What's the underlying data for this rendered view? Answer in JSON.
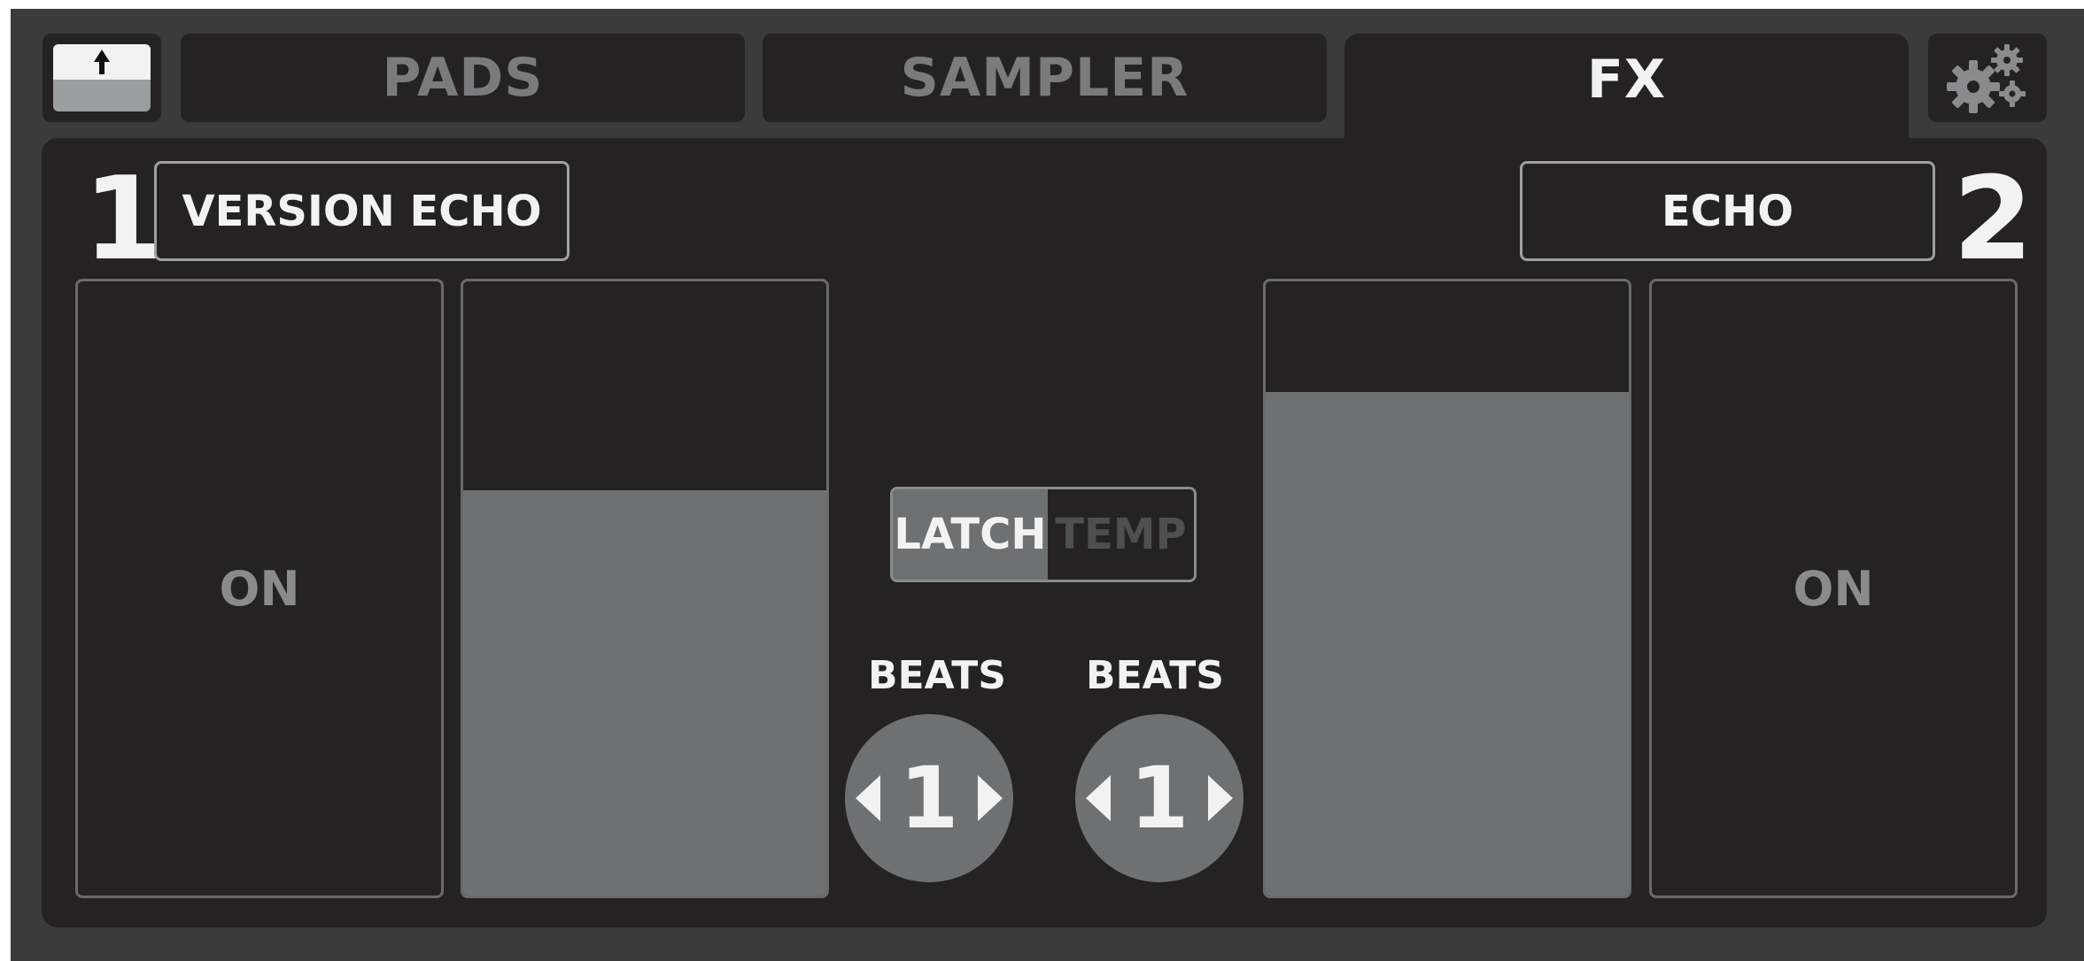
{
  "tabs": [
    {
      "label": "PADS",
      "active": false
    },
    {
      "label": "SAMPLER",
      "active": false
    },
    {
      "label": "FX",
      "active": true
    }
  ],
  "icons": {
    "expand": "arrow-up-icon",
    "settings": "gears-icon"
  },
  "deck1": {
    "number": "1",
    "effect_name": "VERSION ECHO",
    "on_label": "ON",
    "level": 0.66,
    "beats_label": "BEATS",
    "beats_value": "1"
  },
  "deck2": {
    "number": "2",
    "effect_name": "ECHO",
    "on_label": "ON",
    "level": 0.82,
    "beats_label": "BEATS",
    "beats_value": "1"
  },
  "mode": {
    "latch_label": "LATCH",
    "temp_label": "TEMP",
    "selected": "LATCH"
  },
  "colors": {
    "frame": "#3b3b3c",
    "panel": "#242222",
    "fill": "#6f7072",
    "text_active": "#f2f2f2",
    "text_inactive": "#7a7b7d"
  }
}
